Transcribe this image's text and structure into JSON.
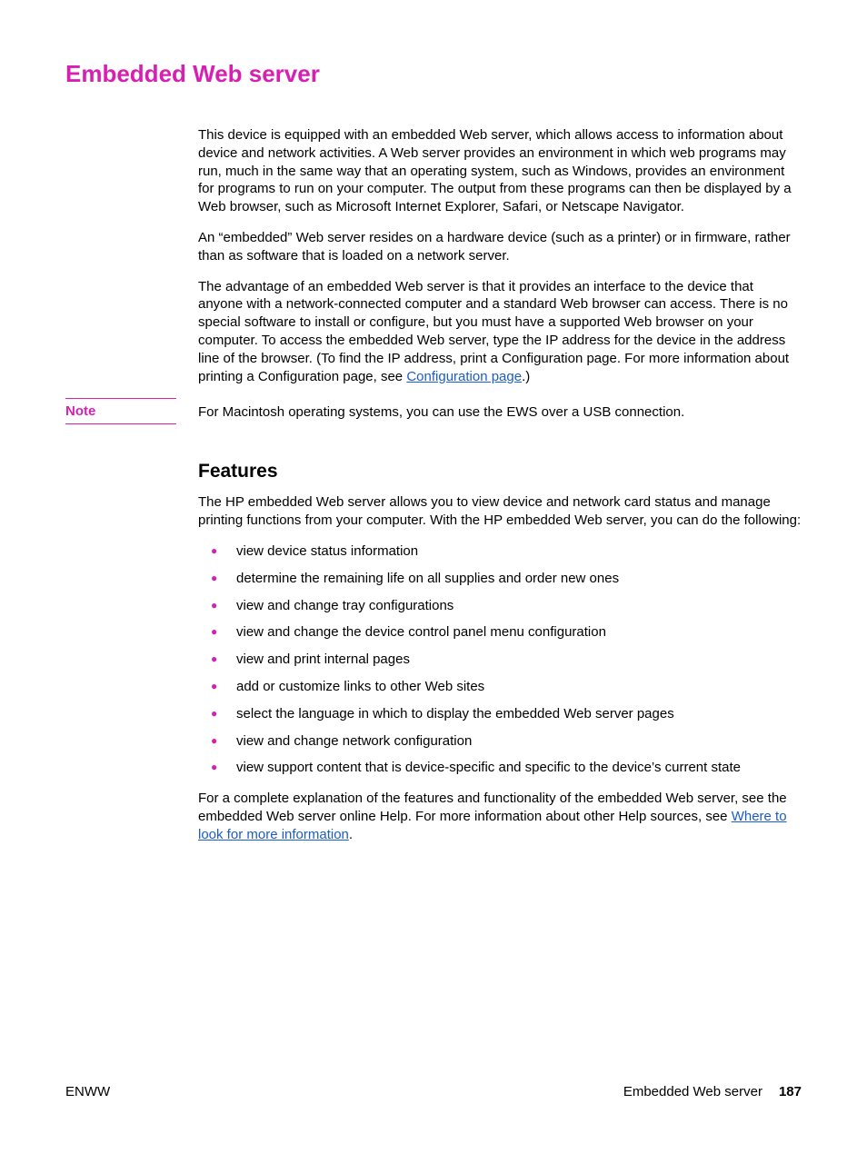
{
  "heading": "Embedded Web server",
  "paragraphs": {
    "p1": "This device is equipped with an embedded Web server, which allows access to information about device and network activities. A Web server provides an environment in which web programs may run, much in the same way that an operating system, such as Windows, provides an environment for programs to run on your computer. The output from these programs can then be displayed by a Web browser, such as Microsoft Internet Explorer, Safari, or Netscape Navigator.",
    "p2": "An “embedded” Web server resides on a hardware device (such as a printer) or in firmware, rather than as software that is loaded on a network server.",
    "p3_a": "The advantage of an embedded Web server is that it provides an interface to the device that anyone with a network-connected computer and a standard Web browser can access. There is no special software to install or configure, but you must have a supported Web browser on your computer. To access the embedded Web server, type the IP address for the device in the address line of the browser. (To find the IP address, print a Configuration page. For more information about printing a Configuration page, see ",
    "p3_link": "Configuration page",
    "p3_b": ".)"
  },
  "note": {
    "label": "Note",
    "body": "For Macintosh operating systems, you can use the EWS over a USB connection."
  },
  "features": {
    "heading": "Features",
    "intro": "The HP embedded Web server allows you to view device and network card status and manage printing functions from your computer. With the HP embedded Web server, you can do the following:",
    "bullets": [
      "view device status information",
      "determine the remaining life on all supplies and order new ones",
      "view and change tray configurations",
      "view and change the device control panel menu configuration",
      "view and print internal pages",
      "add or customize links to other Web sites",
      "select the language in which to display the embedded Web server pages",
      "view and change network configuration",
      "view support content that is device-specific and specific to the device’s current state"
    ],
    "outro_a": "For a complete explanation of the features and functionality of the embedded Web server, see the embedded Web server online Help. For more information about other Help sources, see ",
    "outro_link": "Where to look for more information",
    "outro_b": "."
  },
  "footer": {
    "left": "ENWW",
    "right_label": "Embedded Web server",
    "page": "187"
  }
}
